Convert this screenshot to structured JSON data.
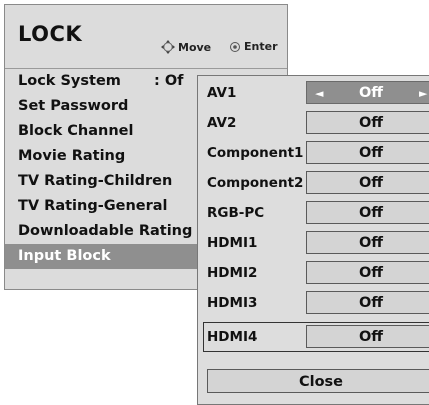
{
  "header": {
    "title": "LOCK",
    "hint_move": "Move",
    "hint_enter": "Enter",
    "move_icon": "four-way-arrow-icon",
    "enter_icon": "enter-circle-icon"
  },
  "menu": {
    "items": [
      {
        "label": "Lock System",
        "value": ": Of"
      },
      {
        "label": "Set Password"
      },
      {
        "label": "Block Channel"
      },
      {
        "label": "Movie Rating"
      },
      {
        "label": "TV Rating-Children"
      },
      {
        "label": "TV Rating-General"
      },
      {
        "label": "Downloadable Rating"
      },
      {
        "label": "Input Block"
      }
    ],
    "selected": "Input Block"
  },
  "input_block": {
    "rows": [
      {
        "label": "AV1",
        "value": "Off",
        "active": true
      },
      {
        "label": "AV2",
        "value": "Off"
      },
      {
        "label": "Component1",
        "value": "Off"
      },
      {
        "label": "Component2",
        "value": "Off"
      },
      {
        "label": "RGB-PC",
        "value": "Off"
      },
      {
        "label": "HDMI1",
        "value": "Off"
      },
      {
        "label": "HDMI2",
        "value": "Off"
      },
      {
        "label": "HDMI3",
        "value": "Off"
      },
      {
        "label": "HDMI4",
        "value": "Off"
      }
    ],
    "arrow_left": "◄",
    "arrow_right": "►",
    "close_label": "Close"
  },
  "colors": {
    "panel_bg": "#dcdcdc",
    "selected_bg": "#8f8f8f",
    "selected_text": "#ffffff"
  }
}
